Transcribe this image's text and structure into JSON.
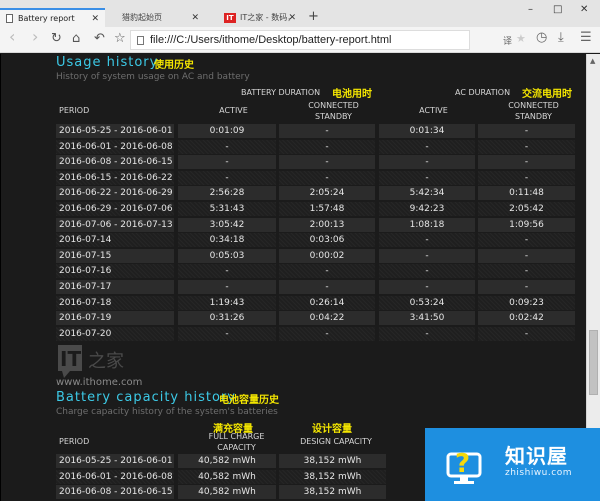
{
  "browser": {
    "tabs": [
      {
        "label": "Battery report",
        "active": true
      },
      {
        "label": "猎豹起始页",
        "active": false
      },
      {
        "label": "IT之家 - 数码，科技，生",
        "active": false,
        "icon": "IT"
      }
    ],
    "new_tab": "+",
    "window_controls": {
      "minimize": "–",
      "maximize": "□",
      "close": "✕"
    },
    "nav": {
      "back": "‹",
      "forward": "›",
      "reload": "↻",
      "home": "⌂",
      "undo": "↶",
      "bookmark": "☆"
    },
    "url": "file:///C:/Users/ithome/Desktop/battery-report.html",
    "toolbar": {
      "translate": "译",
      "star": "★",
      "history": "◷",
      "download": "⤓",
      "menu": "☰"
    }
  },
  "usage_history": {
    "title": "Usage history",
    "title_zh": "使用历史",
    "subtitle": "History of system usage on AC and battery",
    "group_battery": "BATTERY DURATION",
    "group_battery_zh": "电池用时",
    "group_ac": "AC DURATION",
    "group_ac_zh": "交流电用时",
    "columns": [
      "PERIOD",
      "ACTIVE",
      "CONNECTED STANDBY",
      "ACTIVE",
      "CONNECTED STANDBY"
    ],
    "rows": [
      [
        "2016-05-25 - 2016-06-01",
        "0:01:09",
        "-",
        "0:01:34",
        "-"
      ],
      [
        "2016-06-01 - 2016-06-08",
        "-",
        "-",
        "-",
        "-"
      ],
      [
        "2016-06-08 - 2016-06-15",
        "-",
        "-",
        "-",
        "-"
      ],
      [
        "2016-06-15 - 2016-06-22",
        "-",
        "-",
        "-",
        "-"
      ],
      [
        "2016-06-22 - 2016-06-29",
        "2:56:28",
        "2:05:24",
        "5:42:34",
        "0:11:48"
      ],
      [
        "2016-06-29 - 2016-07-06",
        "5:31:43",
        "1:57:48",
        "9:42:23",
        "2:05:42"
      ],
      [
        "2016-07-06 - 2016-07-13",
        "3:05:42",
        "2:00:13",
        "1:08:18",
        "1:09:56"
      ],
      [
        "2016-07-14",
        "0:34:18",
        "0:03:06",
        "-",
        "-"
      ],
      [
        "2016-07-15",
        "0:05:03",
        "0:00:02",
        "-",
        "-"
      ],
      [
        "2016-07-16",
        "-",
        "-",
        "-",
        "-"
      ],
      [
        "2016-07-17",
        "-",
        "-",
        "-",
        "-"
      ],
      [
        "2016-07-18",
        "1:19:43",
        "0:26:14",
        "0:53:24",
        "0:09:23"
      ],
      [
        "2016-07-19",
        "0:31:26",
        "0:04:22",
        "3:41:50",
        "0:02:42"
      ],
      [
        "2016-07-20",
        "-",
        "-",
        "-",
        "-"
      ]
    ]
  },
  "logo": {
    "mark": "IT",
    "url": "www.ithome.com"
  },
  "capacity_history": {
    "title": "Battery capacity history",
    "title_zh": "电池容量历史",
    "subtitle": "Charge capacity history of the system's batteries",
    "full_zh": "满充容量",
    "design_zh": "设计容量",
    "columns": [
      "PERIOD",
      "FULL CHARGE CAPACITY",
      "DESIGN CAPACITY"
    ],
    "rows": [
      [
        "2016-05-25 - 2016-06-01",
        "40,582 mWh",
        "38,152 mWh"
      ],
      [
        "2016-06-01 - 2016-06-08",
        "40,582 mWh",
        "38,152 mWh"
      ],
      [
        "2016-06-08 - 2016-06-15",
        "40,582 mWh",
        "38,152 mWh"
      ]
    ]
  },
  "watermark": {
    "title": "知识屋",
    "subtitle": "zhishiwu.com"
  }
}
